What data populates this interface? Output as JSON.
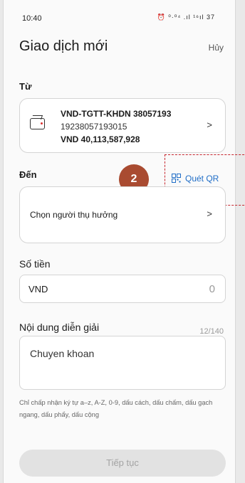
{
  "status_bar": {
    "time": "10:40",
    "icons": "⏰ ⁰·⁰⁴ .ıl ¹⁶ıl 37"
  },
  "header": {
    "title": "Giao dịch mới",
    "cancel_label": "Hủy"
  },
  "from": {
    "label": "Từ",
    "account_name": "VND-TGTT-KHDN 38057193",
    "account_number": "19238057193015",
    "balance": "VND 40,113,587,928"
  },
  "to": {
    "label": "Đến",
    "qr_label": "Quét QR",
    "placeholder": "Chọn người thụ hưởng"
  },
  "amount": {
    "label": "Số tiền",
    "currency": "VND",
    "value": "0"
  },
  "description": {
    "label": "Nội dung diễn giải",
    "counter": "12/140",
    "value": "Chuyen khoan",
    "hint": "Chỉ chấp nhận ký tự a–z, A-Z, 0-9, dấu cách, dấu chấm, dấu gạch ngang, dấu phẩy, dấu cộng"
  },
  "annotation": {
    "step_number": "2",
    "color": "#a94b31",
    "highlight_color": "#c6262e"
  },
  "continue_label": "Tiếp tục",
  "colors": {
    "link": "#1f6dc7",
    "disabled_button": "#e2e2e2"
  }
}
